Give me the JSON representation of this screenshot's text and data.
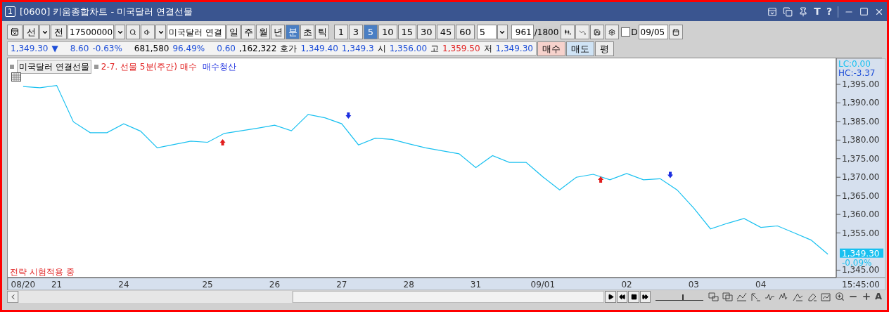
{
  "window": {
    "badge": "1",
    "title": "[0600] 키움종합차트 - 미국달러 연결선물",
    "tool_glyphs": [
      "T",
      "?"
    ]
  },
  "toolbar": {
    "market": "선",
    "prev": "전",
    "code": "17500000",
    "name": "미국달러 연결",
    "periods": [
      {
        "label": "일",
        "selected": false
      },
      {
        "label": "주",
        "selected": false
      },
      {
        "label": "월",
        "selected": false
      },
      {
        "label": "년",
        "selected": false
      },
      {
        "label": "분",
        "selected": true
      },
      {
        "label": "초",
        "selected": false
      },
      {
        "label": "틱",
        "selected": false
      }
    ],
    "intervals": [
      {
        "label": "1",
        "selected": false
      },
      {
        "label": "3",
        "selected": false
      },
      {
        "label": "5",
        "selected": true
      },
      {
        "label": "10",
        "selected": false
      },
      {
        "label": "15",
        "selected": false
      },
      {
        "label": "30",
        "selected": false
      },
      {
        "label": "45",
        "selected": false
      },
      {
        "label": "60",
        "selected": false
      }
    ],
    "interval_select": "5",
    "count": "961",
    "count_max": "/1800",
    "d_checkbox": {
      "label": "D",
      "checked": false
    },
    "date": "09/05"
  },
  "quote": {
    "items": [
      {
        "text": "1,349.30",
        "color": "#1d4ed8"
      },
      {
        "text": "▼",
        "color": "#1d4ed8"
      },
      {
        "text": "8.60",
        "color": "#1d4ed8"
      },
      {
        "text": "-0.63%",
        "color": "#1d4ed8"
      },
      {
        "text": "681,580"
      },
      {
        "text": "96.49%",
        "color": "#1d4ed8"
      },
      {
        "text": "0.60",
        "color": "#1d4ed8"
      },
      {
        "text": ",162,322"
      },
      {
        "text": "호가"
      },
      {
        "text": "1,349.40",
        "color": "#1d4ed8"
      },
      {
        "text": "1,349.3",
        "color": "#1d4ed8"
      },
      {
        "text": "시"
      },
      {
        "text": "1,356.00",
        "color": "#1d4ed8"
      },
      {
        "text": "고"
      },
      {
        "text": "1,359.50",
        "color": "#e11d1d"
      },
      {
        "text": "저"
      },
      {
        "text": "1,349.30",
        "color": "#1d4ed8"
      }
    ],
    "buttons": [
      {
        "label": "매수",
        "kind": "buy"
      },
      {
        "label": "매도",
        "kind": "sell"
      },
      {
        "label": "평",
        "kind": "plain"
      }
    ]
  },
  "chart": {
    "legend": {
      "strategy": "2-7. 선물 5분(주간) 매수",
      "exit": "매수청산"
    },
    "lc": "LC:0.00",
    "hc": "HC:-3.37",
    "current": "1,349.30",
    "change": "-0.09%",
    "time": "15:45:00",
    "status_text": "전략 시험적용 중",
    "signals": [
      {
        "kind": "buy"
      },
      {
        "kind": "sell"
      },
      {
        "kind": "buy"
      },
      {
        "kind": "sell"
      }
    ],
    "chart_data": {
      "type": "line",
      "ylim": [
        1343,
        1402
      ],
      "categories": [
        "08/20",
        null,
        "21",
        null,
        null,
        null,
        "24",
        null,
        null,
        null,
        null,
        "25",
        null,
        null,
        null,
        "26",
        null,
        null,
        null,
        "27",
        null,
        null,
        null,
        "28",
        null,
        null,
        null,
        "31",
        null,
        null,
        null,
        "09/01",
        null,
        null,
        null,
        null,
        "02",
        null,
        null,
        null,
        "03",
        null,
        null,
        null,
        "04",
        null,
        null,
        null,
        null
      ],
      "series": [
        {
          "name": "미국달러 연결선물",
          "color": "#18c0f0",
          "values": [
            1394.4,
            1394.1,
            1394.7,
            1384.9,
            1382,
            1382,
            1384.4,
            1382.4,
            1377.9,
            1378.8,
            1379.7,
            1379.4,
            1381.8,
            1382.5,
            1383.2,
            1384,
            1382.5,
            1386.9,
            1386,
            1384.4,
            1378.7,
            1380.5,
            1380.2,
            1379,
            1377.9,
            1377.1,
            1376.3,
            1372.6,
            1375.8,
            1374,
            1374,
            1370.1,
            1366.6,
            1370,
            1370.8,
            1369.3,
            1371,
            1369.3,
            1369.6,
            1366.6,
            1361.7,
            1356.1,
            1357.6,
            1358.9,
            1356.5,
            1356.9,
            1355,
            1353.1,
            1349.3
          ]
        }
      ],
      "yticks": [
        {
          "value": 1395,
          "label": "1,395.00"
        },
        {
          "value": 1390,
          "label": "1,390.00"
        },
        {
          "value": 1385,
          "label": "1,385.00"
        },
        {
          "value": 1380,
          "label": "1,380.00"
        },
        {
          "value": 1375,
          "label": "1,375.00"
        },
        {
          "value": 1370,
          "label": "1,370.00"
        },
        {
          "value": 1365,
          "label": "1,365.00"
        },
        {
          "value": 1360,
          "label": "1,360.00"
        },
        {
          "value": 1355,
          "label": "1,355.00"
        },
        {
          "value": 1345,
          "label": "1,345.00"
        }
      ]
    }
  },
  "bottom": {
    "zoom_slider": {
      "level": 0.55
    },
    "font_button": "A"
  }
}
